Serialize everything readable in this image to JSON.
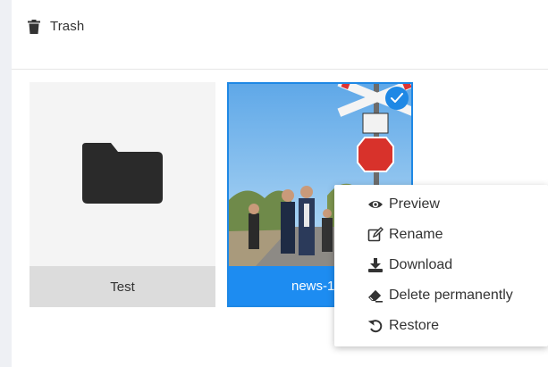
{
  "header": {
    "title": "Trash"
  },
  "items": [
    {
      "caption": "Test",
      "type": "folder"
    },
    {
      "caption": "news-1",
      "type": "image",
      "selected": true
    }
  ],
  "context_menu": {
    "items": [
      {
        "label": "Preview",
        "icon": "eye-icon"
      },
      {
        "label": "Rename",
        "icon": "edit-icon"
      },
      {
        "label": "Download",
        "icon": "download-icon"
      },
      {
        "label": "Delete permanently",
        "icon": "eraser-icon"
      },
      {
        "label": "Restore",
        "icon": "undo-icon"
      }
    ]
  },
  "colors": {
    "accent": "#1e88e5",
    "folder_caption_bg": "#dcdcdc",
    "rail": "#eef0f4"
  }
}
